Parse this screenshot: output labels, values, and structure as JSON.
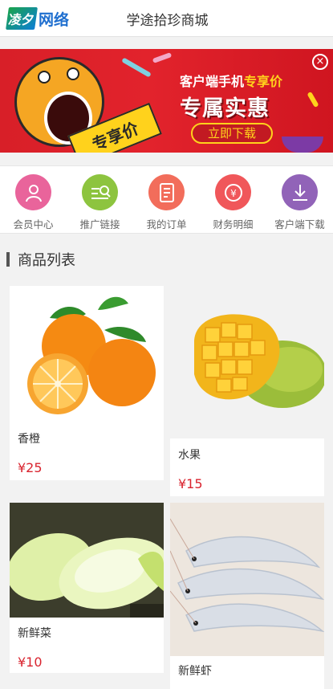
{
  "header": {
    "logo_mark": "凌夕",
    "logo_text": "网络",
    "title": "学途拾珍商城"
  },
  "banner": {
    "line1_prefix": "客户端手机",
    "line1_highlight": "专享价",
    "headline": "专属实惠",
    "ribbon": "专享价",
    "button": "立即下载",
    "close": "×"
  },
  "nav": [
    {
      "label": "会员中心",
      "icon": "user-icon",
      "color": "#e9649b"
    },
    {
      "label": "推广链接",
      "icon": "search-list-icon",
      "color": "#8dc43f"
    },
    {
      "label": "我的订单",
      "icon": "document-icon",
      "color": "#f26d5b"
    },
    {
      "label": "财务明细",
      "icon": "yuan-icon",
      "color": "#f0575a"
    },
    {
      "label": "客户端下载",
      "icon": "download-icon",
      "color": "#9163b8"
    }
  ],
  "section_title": "商品列表",
  "products": [
    {
      "name": "香橙",
      "price": "¥25"
    },
    {
      "name": "水果",
      "price": "¥15"
    },
    {
      "name": "新鲜菜",
      "price": "¥10"
    },
    {
      "name": "新鲜虾",
      "price": ""
    }
  ]
}
